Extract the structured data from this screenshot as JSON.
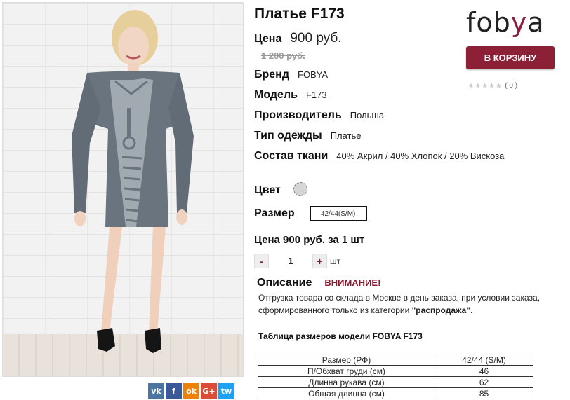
{
  "product": {
    "title": "Платье F173",
    "price_label": "Цена",
    "price": "900 руб.",
    "old_price": "1 200 руб.",
    "brand_label": "Бренд",
    "brand": "FOBYA",
    "model_label": "Модель",
    "model": "F173",
    "manufacturer_label": "Производитель",
    "manufacturer": "Польша",
    "type_label": "Тип одежды",
    "type": "Платье",
    "fabric_label": "Состав ткани",
    "fabric": "40% Акрил / 40% Хлопок / 20% Вискоза",
    "color_label": "Цвет",
    "color_hex": "#d5d5d5",
    "size_label": "Размер",
    "size_selected": "42/44(S/M)",
    "unit_price_line": "Цена 900 руб. за 1 шт"
  },
  "quantity": {
    "minus": "-",
    "value": "1",
    "plus": "+",
    "unit": "шт"
  },
  "header": {
    "logo_text_1": "fob",
    "logo_text_2": "y",
    "logo_text_3": "a",
    "cart_button": "В КОРЗИНУ",
    "rating_stars": "★★★★★",
    "rating_count": "( 0 )"
  },
  "description": {
    "label": "Описание",
    "warning": "ВНИМАНИЕ!",
    "text_before": "Отгрузка товара со склада в Москве в день заказа, при условии заказа, сформированного только из категории ",
    "text_bold": "\"распродажа\"",
    "text_after": "."
  },
  "size_table": {
    "title": "Таблица размеров модели FOBYA F173",
    "rows": [
      [
        "Размер (РФ)",
        "42/44 (S/M)"
      ],
      [
        "П/Обхват груди (см)",
        "46"
      ],
      [
        "Длинна рукава (см)",
        "62"
      ],
      [
        "Общая длинна (см)",
        "85"
      ]
    ]
  },
  "share": [
    "vk",
    "f",
    "ok",
    "G+",
    "tw"
  ],
  "colors": {
    "accent": "#8b2037",
    "vk": "#4c75a3",
    "fb": "#3b5998",
    "ok": "#ee8208",
    "gplus": "#dd4b39",
    "tw": "#1da1f2"
  }
}
